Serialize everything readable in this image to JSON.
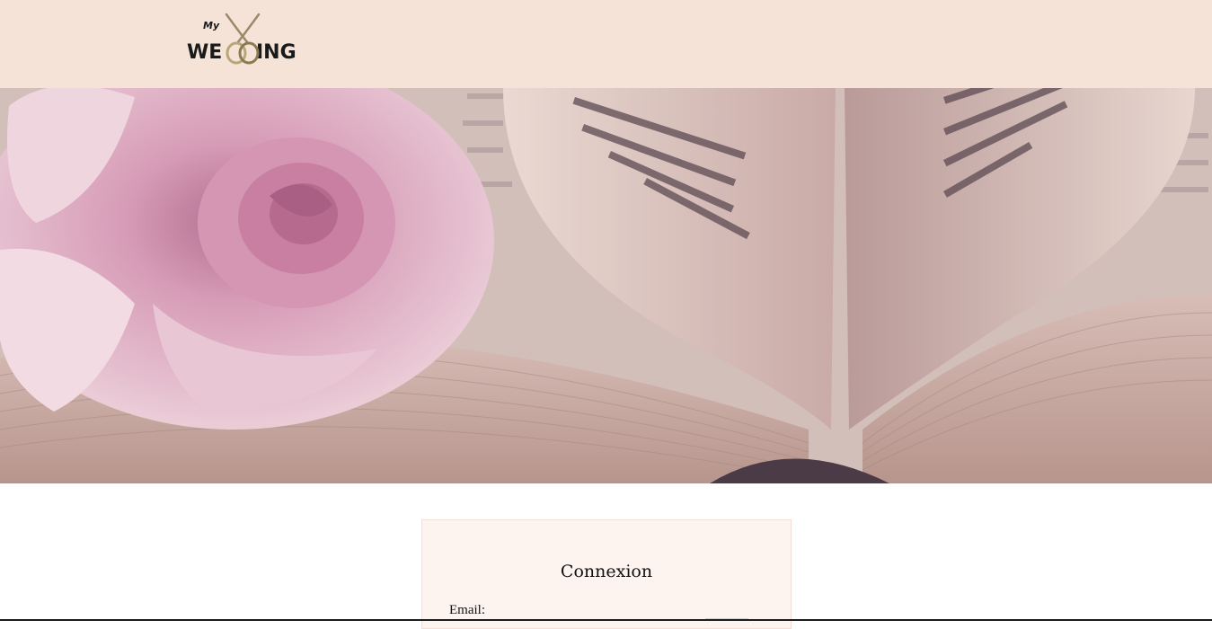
{
  "header": {
    "logo": {
      "small_text": "My",
      "left_text": "WE",
      "right_text": "ING"
    }
  },
  "login": {
    "title": "Connexion",
    "email_label": "Email:"
  }
}
